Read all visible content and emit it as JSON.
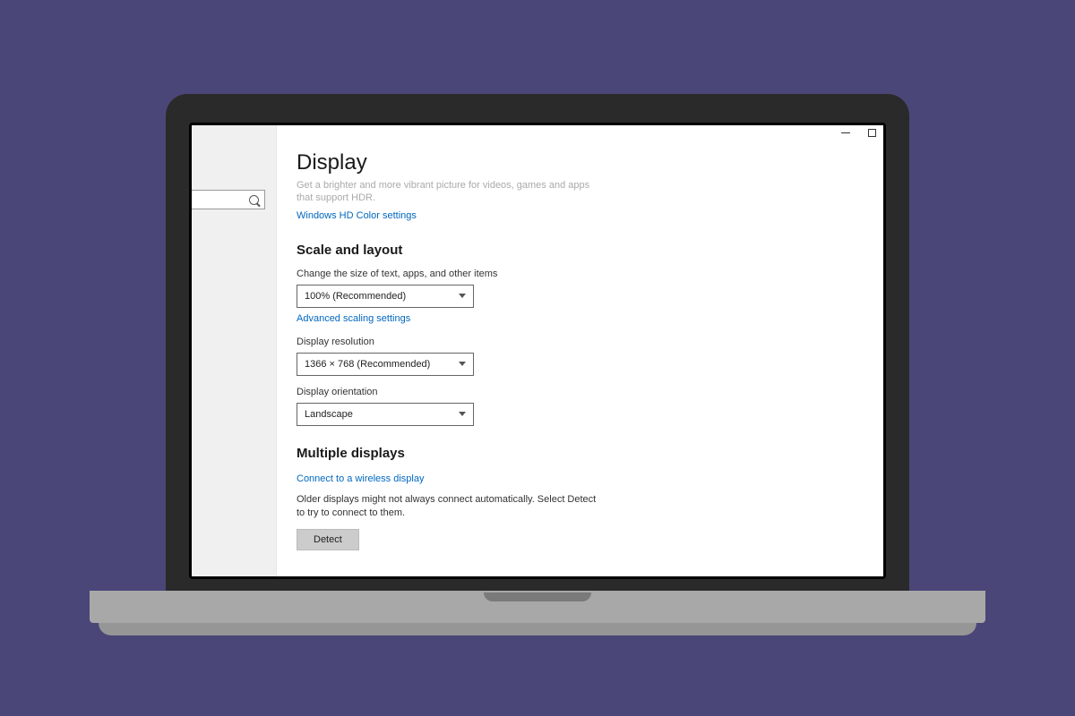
{
  "page": {
    "title": "Display",
    "hdr_desc": "Get a brighter and more vibrant picture for videos, games and apps that support HDR.",
    "hdr_link": "Windows HD Color settings"
  },
  "scale": {
    "heading": "Scale and layout",
    "size_label": "Change the size of text, apps, and other items",
    "size_value": "100% (Recommended)",
    "adv_link": "Advanced scaling settings",
    "res_label": "Display resolution",
    "res_value": "1366 × 768 (Recommended)",
    "orient_label": "Display orientation",
    "orient_value": "Landscape"
  },
  "multi": {
    "heading": "Multiple displays",
    "wireless_link": "Connect to a wireless display",
    "info": "Older displays might not always connect automatically. Select Detect to try to connect to them.",
    "detect_btn": "Detect"
  }
}
